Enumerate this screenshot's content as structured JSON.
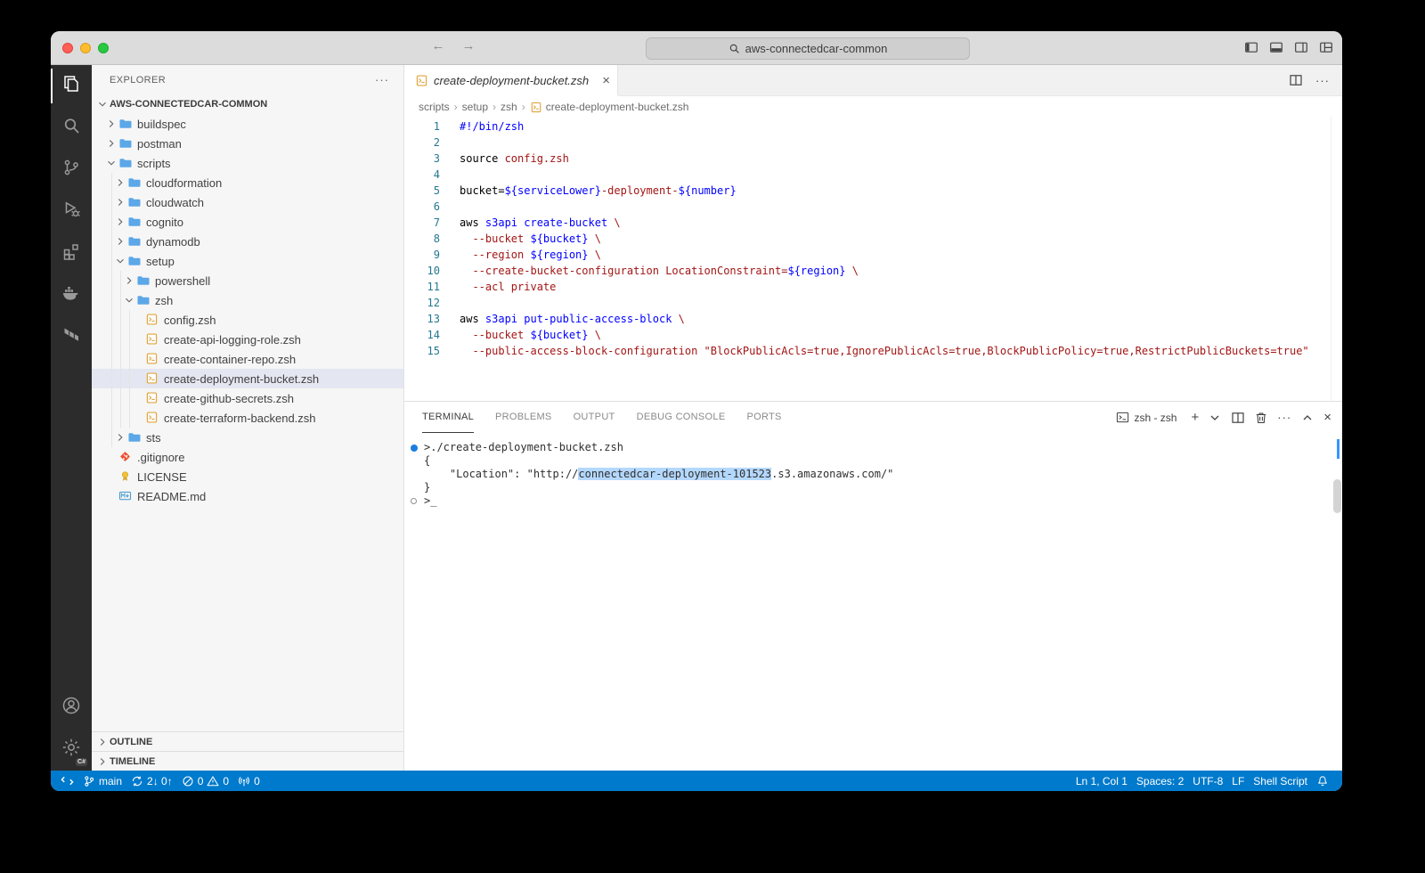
{
  "title_bar": {
    "search_text": "aws-connectedcar-common",
    "window_controls": [
      "close",
      "minimize",
      "zoom"
    ]
  },
  "activity_bar": {
    "top": [
      {
        "name": "explorer",
        "icon": "files-icon",
        "active": true
      },
      {
        "name": "search",
        "icon": "search-icon",
        "active": false
      },
      {
        "name": "source-control",
        "icon": "source-control-icon",
        "active": false
      },
      {
        "name": "run-and-debug",
        "icon": "debug-icon",
        "active": false
      },
      {
        "name": "extensions",
        "icon": "extensions-icon",
        "active": false
      },
      {
        "name": "docker",
        "icon": "docker-icon",
        "active": false
      },
      {
        "name": "terraform",
        "icon": "terraform-icon",
        "active": false
      }
    ],
    "bottom": [
      {
        "name": "accounts",
        "icon": "account-icon"
      },
      {
        "name": "manage",
        "icon": "gear-icon",
        "badge": "C#"
      }
    ]
  },
  "explorer": {
    "title": "EXPLORER",
    "root": "AWS-CONNECTEDCAR-COMMON",
    "sections": [
      "OUTLINE",
      "TIMELINE"
    ],
    "tree": [
      {
        "label": "buildspec",
        "type": "folder",
        "depth": 0,
        "expanded": false
      },
      {
        "label": "postman",
        "type": "folder",
        "depth": 0,
        "expanded": false
      },
      {
        "label": "scripts",
        "type": "folder",
        "depth": 0,
        "expanded": true
      },
      {
        "label": "cloudformation",
        "type": "folder",
        "depth": 1,
        "expanded": false
      },
      {
        "label": "cloudwatch",
        "type": "folder",
        "depth": 1,
        "expanded": false
      },
      {
        "label": "cognito",
        "type": "folder",
        "depth": 1,
        "expanded": false
      },
      {
        "label": "dynamodb",
        "type": "folder",
        "depth": 1,
        "expanded": false
      },
      {
        "label": "setup",
        "type": "folder",
        "depth": 1,
        "expanded": true
      },
      {
        "label": "powershell",
        "type": "folder",
        "depth": 2,
        "expanded": false
      },
      {
        "label": "zsh",
        "type": "folder",
        "depth": 2,
        "expanded": true
      },
      {
        "label": "config.zsh",
        "type": "file",
        "icon": "shell",
        "depth": 3
      },
      {
        "label": "create-api-logging-role.zsh",
        "type": "file",
        "icon": "shell",
        "depth": 3
      },
      {
        "label": "create-container-repo.zsh",
        "type": "file",
        "icon": "shell",
        "depth": 3
      },
      {
        "label": "create-deployment-bucket.zsh",
        "type": "file",
        "icon": "shell",
        "depth": 3,
        "selected": true
      },
      {
        "label": "create-github-secrets.zsh",
        "type": "file",
        "icon": "shell",
        "depth": 3
      },
      {
        "label": "create-terraform-backend.zsh",
        "type": "file",
        "icon": "shell",
        "depth": 3
      },
      {
        "label": "sts",
        "type": "folder",
        "depth": 1,
        "expanded": false
      },
      {
        "label": ".gitignore",
        "type": "file",
        "icon": "git",
        "depth": 0
      },
      {
        "label": "LICENSE",
        "type": "file",
        "icon": "license",
        "depth": 0
      },
      {
        "label": "README.md",
        "type": "file",
        "icon": "markdown",
        "depth": 0
      }
    ]
  },
  "editor": {
    "tab_label": "create-deployment-bucket.zsh",
    "breadcrumbs": [
      "scripts",
      "setup",
      "zsh",
      "create-deployment-bucket.zsh"
    ],
    "code": {
      "language": "zsh",
      "lines": [
        {
          "n": 1,
          "seg": [
            [
              "#!/bin/zsh",
              "b"
            ]
          ]
        },
        {
          "n": 2,
          "seg": []
        },
        {
          "n": 3,
          "seg": [
            [
              "source ",
              "k"
            ],
            [
              "config.zsh",
              "r"
            ]
          ]
        },
        {
          "n": 4,
          "seg": []
        },
        {
          "n": 5,
          "seg": [
            [
              "bucket=",
              "k"
            ],
            [
              "${serviceLower}",
              "b"
            ],
            [
              "-deployment-",
              "r"
            ],
            [
              "${number}",
              "b"
            ]
          ]
        },
        {
          "n": 6,
          "seg": []
        },
        {
          "n": 7,
          "seg": [
            [
              "aws ",
              "k"
            ],
            [
              "s3api create-bucket",
              "b"
            ],
            [
              " \\",
              "r"
            ]
          ]
        },
        {
          "n": 8,
          "seg": [
            [
              "  --bucket ",
              "r"
            ],
            [
              "${bucket}",
              "b"
            ],
            [
              " \\",
              "r"
            ]
          ]
        },
        {
          "n": 9,
          "seg": [
            [
              "  --region ",
              "r"
            ],
            [
              "${region}",
              "b"
            ],
            [
              " \\",
              "r"
            ]
          ]
        },
        {
          "n": 10,
          "seg": [
            [
              "  --create-bucket-configuration LocationConstraint=",
              "r"
            ],
            [
              "${region}",
              "b"
            ],
            [
              " \\",
              "r"
            ]
          ]
        },
        {
          "n": 11,
          "seg": [
            [
              "  --acl private",
              "r"
            ]
          ]
        },
        {
          "n": 12,
          "seg": []
        },
        {
          "n": 13,
          "seg": [
            [
              "aws ",
              "k"
            ],
            [
              "s3api put-public-access-block",
              "b"
            ],
            [
              " \\",
              "r"
            ]
          ]
        },
        {
          "n": 14,
          "seg": [
            [
              "  --bucket ",
              "r"
            ],
            [
              "${bucket}",
              "b"
            ],
            [
              " \\",
              "r"
            ]
          ]
        },
        {
          "n": 15,
          "seg": [
            [
              "  --public-access-block-configuration ",
              "r"
            ],
            [
              "\"BlockPublicAcls=true,IgnorePublicAcls=true,BlockPublicPolicy=true,RestrictPublicBuckets=true\"",
              "r"
            ]
          ]
        }
      ]
    }
  },
  "panel": {
    "tabs": [
      {
        "label": "TERMINAL",
        "active": true
      },
      {
        "label": "PROBLEMS",
        "active": false
      },
      {
        "label": "OUTPUT",
        "active": false
      },
      {
        "label": "DEBUG CONSOLE",
        "active": false
      },
      {
        "label": "PORTS",
        "active": false
      }
    ],
    "profile": "zsh - zsh",
    "terminal_lines": [
      {
        "dec": "filled",
        "seg": [
          [
            ">./create-deployment-bucket.zsh",
            ""
          ]
        ]
      },
      {
        "dec": "",
        "seg": [
          [
            "{",
            ""
          ]
        ]
      },
      {
        "dec": "",
        "seg": [
          [
            "    \"Location\": \"http://",
            ""
          ],
          [
            "connectedcar-deployment-101523",
            "sel"
          ],
          [
            ".s3.amazonaws.com/\"",
            ""
          ]
        ]
      },
      {
        "dec": "",
        "seg": [
          [
            "}",
            ""
          ]
        ]
      },
      {
        "dec": "open",
        "seg": [
          [
            ">",
            ""
          ],
          [
            "_",
            ""
          ]
        ]
      }
    ]
  },
  "status_bar": {
    "branch": "main",
    "sync": "2↓ 0↑",
    "errors": "0",
    "warnings": "0",
    "ports": "0",
    "line_col": "Ln 1, Col 1",
    "indent": "Spaces: 2",
    "encoding": "UTF-8",
    "eol": "LF",
    "language": "Shell Script"
  }
}
